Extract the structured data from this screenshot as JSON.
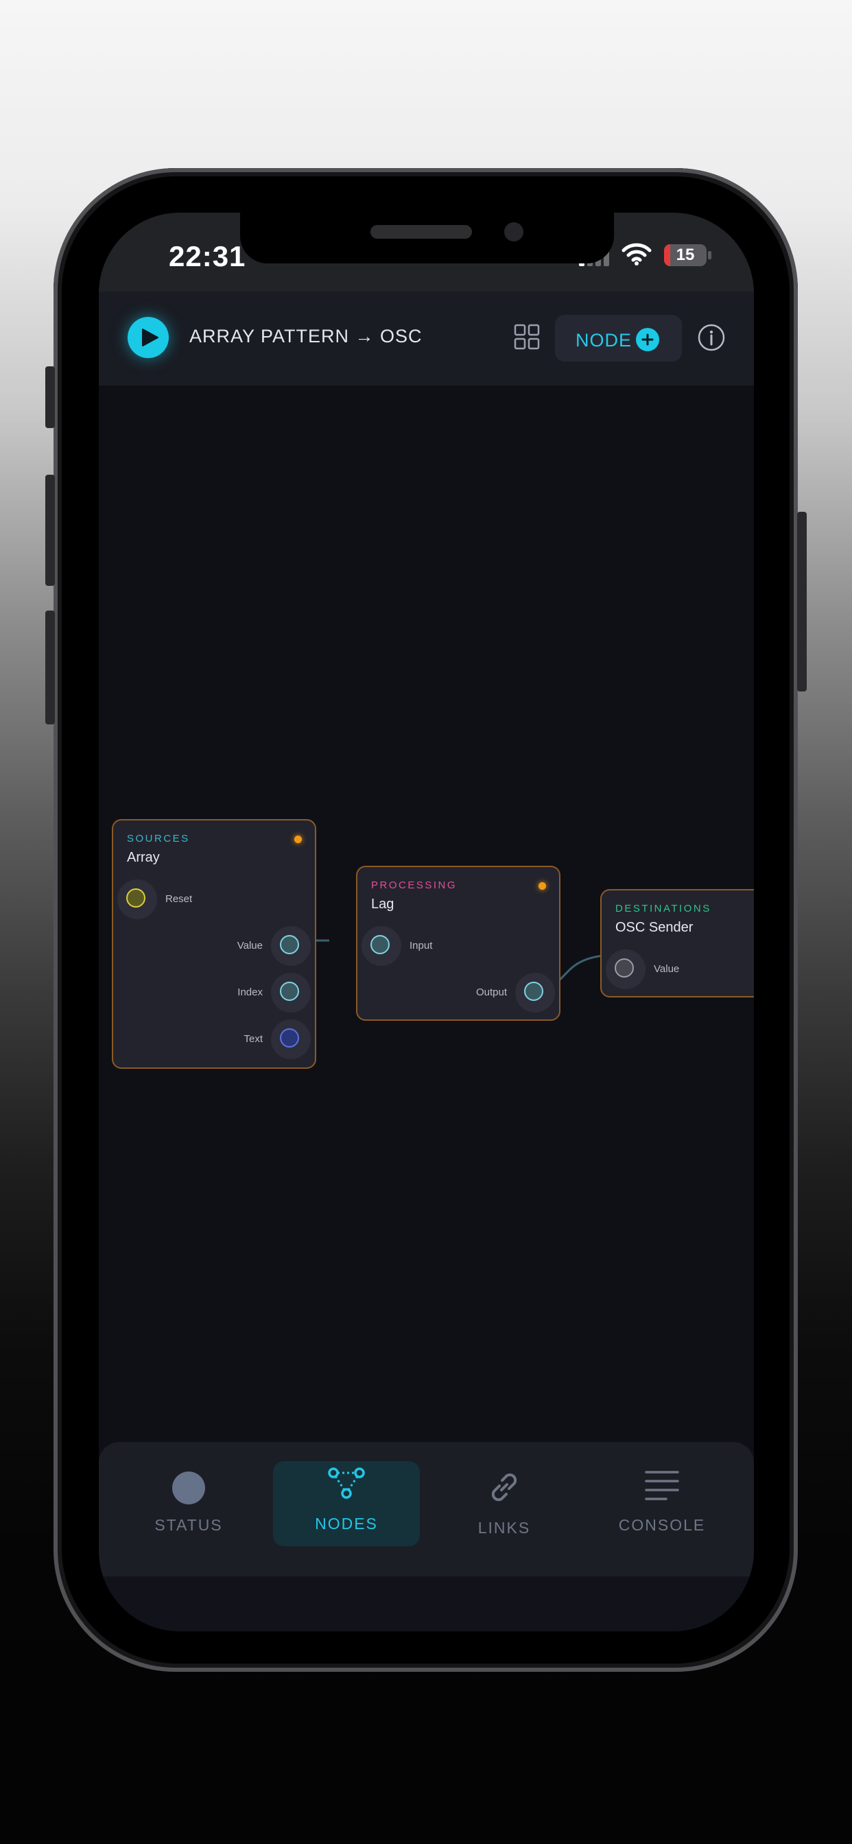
{
  "status_bar": {
    "time": "22:31",
    "battery": "15",
    "battery_fraction": 0.15
  },
  "header": {
    "title": "ARRAY PATTERN → OSC",
    "node_button_label": "NODE"
  },
  "nodes": [
    {
      "category": "SOURCES",
      "name": "Array",
      "category_color": "#39b7cc",
      "inputs": [
        "Reset"
      ],
      "outputs": [
        "Value",
        "Index",
        "Text"
      ]
    },
    {
      "category": "PROCESSING",
      "name": "Lag",
      "category_color": "#e0509b",
      "inputs": [
        "Input"
      ],
      "outputs": [
        "Output"
      ]
    },
    {
      "category": "DESTINATIONS",
      "name": "OSC Sender",
      "category_color": "#2fc48a",
      "inputs": [
        "Value"
      ],
      "outputs": []
    }
  ],
  "tabs": [
    {
      "label": "STATUS",
      "icon": "circle-icon",
      "active": false
    },
    {
      "label": "NODES",
      "icon": "node-graph-icon",
      "active": true
    },
    {
      "label": "LINKS",
      "icon": "link-icon",
      "active": false
    },
    {
      "label": "CONSOLE",
      "icon": "menu-lines-icon",
      "active": false
    }
  ],
  "colors": {
    "accent": "#19c9e6",
    "node_border": "#8a5a26",
    "status_led": "#f39a14"
  }
}
